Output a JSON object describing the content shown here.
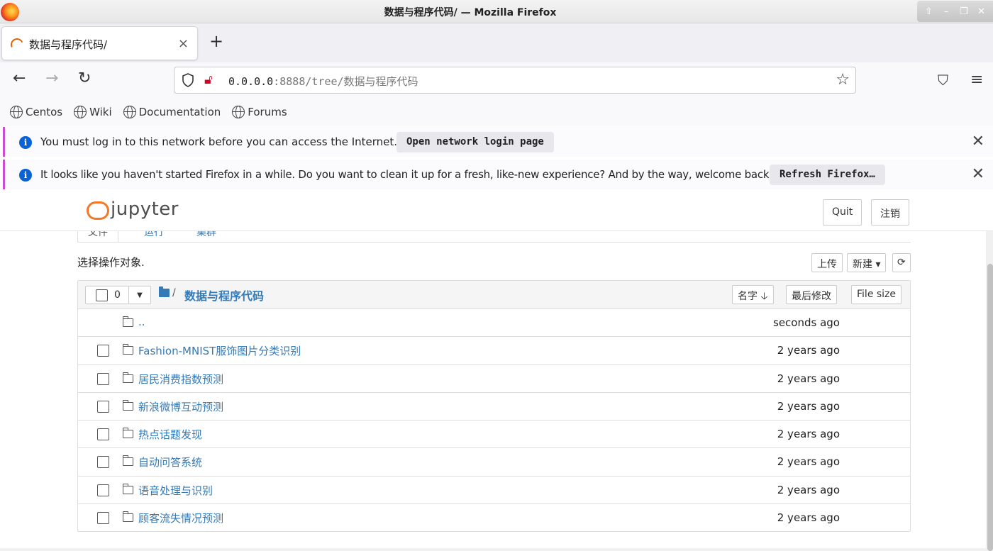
{
  "window": {
    "title": "数据与程序代码/ — Mozilla Firefox",
    "controls": [
      "⇧",
      "–",
      "❐",
      "✕"
    ]
  },
  "tab": {
    "label": "数据与程序代码/",
    "close": "×",
    "new_tab": "+"
  },
  "nav": {
    "back": "←",
    "forward": "→",
    "reload": "↻",
    "url_host": "0.0.0.0",
    "url_rest": ":8888/tree/数据与程序代码",
    "star": "☆",
    "pocket": "⛉",
    "menu": "≡"
  },
  "bookmarks": [
    "Centos",
    "Wiki",
    "Documentation",
    "Forums"
  ],
  "notices": [
    {
      "text": "You must log in to this network before you can access the Internet.",
      "button": "Open network login page",
      "close": "✕"
    },
    {
      "text": "It looks like you haven't started Firefox in a while. Do you want to clean it up for a fresh, like-new experience? And by the way, welcome back!",
      "button": "Refresh Firefox…",
      "close": "✕"
    }
  ],
  "jupyter": {
    "logo_text": "jupyter",
    "quit": "Quit",
    "logout": "注销",
    "tabs": [
      "文件",
      "运行",
      "集群"
    ],
    "select_label": "选择操作对象.",
    "upload": "上传",
    "new": "新建 ▾",
    "refresh": "⟳",
    "selected_count": "0",
    "breadcrumb_sep": "/",
    "breadcrumb": "数据与程序代码",
    "sort_name": "名字 🡣",
    "sort_modified": "最后修改",
    "sort_size": "File size",
    "parent": {
      "name": "..",
      "time": "seconds ago"
    },
    "files": [
      {
        "name": "Fashion-MNIST服饰图片分类识别",
        "time": "2 years ago"
      },
      {
        "name": "居民消费指数预测",
        "time": "2 years ago"
      },
      {
        "name": "新浪微博互动预测",
        "time": "2 years ago"
      },
      {
        "name": "热点话题发现",
        "time": "2 years ago"
      },
      {
        "name": "自动问答系统",
        "time": "2 years ago"
      },
      {
        "name": "语音处理与识别",
        "time": "2 years ago"
      },
      {
        "name": "顾客流失情况预测",
        "time": "2 years ago"
      }
    ]
  }
}
